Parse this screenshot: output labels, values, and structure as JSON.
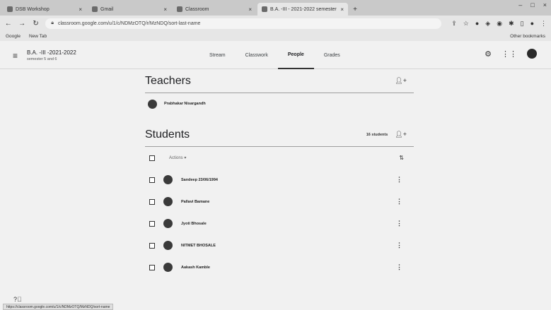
{
  "browser": {
    "tabs": [
      {
        "label": "DSB Workshop",
        "active": false
      },
      {
        "label": "Gmail",
        "active": false
      },
      {
        "label": "Classroom",
        "active": false
      },
      {
        "label": "B.A. -III - 2021-2022 semester",
        "active": true
      }
    ],
    "address": "classroom.google.com/u/1/c/NDMzOTQ/r/MzNDQ/sort-last-name",
    "bookmarks": [
      {
        "label": "Google"
      },
      {
        "label": "New Tab"
      }
    ],
    "bookmarks_right": "Other bookmarks",
    "status_url": "https://classroom.google.com/u/1/c/NDMzOTQ/MzNDQ/sort-name"
  },
  "class": {
    "title": "B.A. -III -2021-2022",
    "subtitle": "semester 5 and 6"
  },
  "nav": {
    "tabs": [
      {
        "label": "Stream"
      },
      {
        "label": "Classwork"
      },
      {
        "label": "People"
      },
      {
        "label": "Grades"
      }
    ],
    "active_index": 2
  },
  "teachers": {
    "title": "Teachers",
    "list": [
      {
        "name": "Prabhakar Nisargandh"
      }
    ]
  },
  "students": {
    "title": "Students",
    "count_label": "16 students",
    "actions_label": "Actions",
    "list": [
      {
        "name": "Sandeep 23/06/1994"
      },
      {
        "name": "Pallavi Bamane"
      },
      {
        "name": "Jyoti Bhosale"
      },
      {
        "name": "NITMET BHOSALE"
      },
      {
        "name": "Aakash Kamble"
      }
    ]
  }
}
